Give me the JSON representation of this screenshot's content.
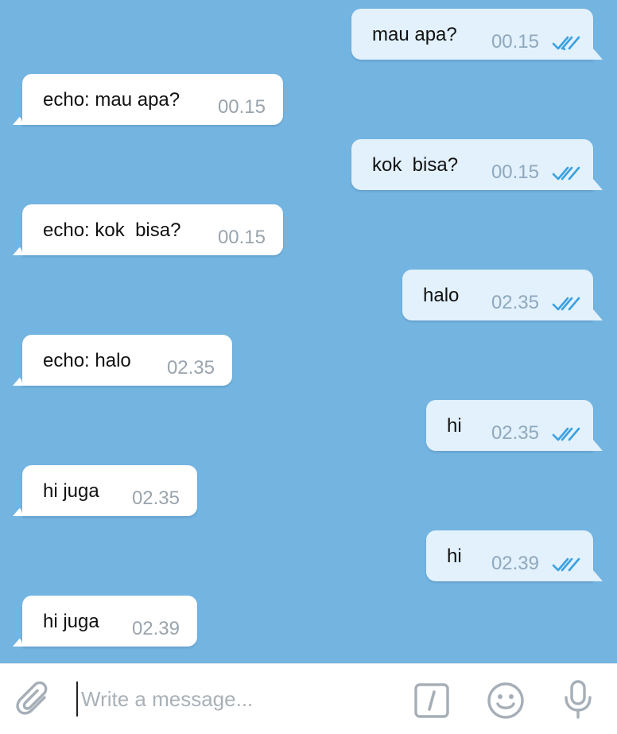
{
  "colors": {
    "chat_background": "#74b4e0",
    "incoming_bubble": "#ffffff",
    "outgoing_bubble": "#e2f1fc",
    "read_check": "#3aa0e0",
    "icon_gray": "#a6afb7"
  },
  "messages": [
    {
      "direction": "out",
      "text": "mau apa?",
      "time": "00.15",
      "status_icon": "double-check-icon"
    },
    {
      "direction": "in",
      "text": "echo: mau apa?",
      "time": "00.15"
    },
    {
      "direction": "out",
      "text": "kok  bisa?",
      "time": "00.15",
      "status_icon": "double-check-icon"
    },
    {
      "direction": "in",
      "text": "echo: kok  bisa?",
      "time": "00.15"
    },
    {
      "direction": "out",
      "text": "halo",
      "time": "02.35",
      "status_icon": "double-check-icon"
    },
    {
      "direction": "in",
      "text": "echo: halo",
      "time": "02.35"
    },
    {
      "direction": "out",
      "text": "hi",
      "time": "02.35",
      "status_icon": "double-check-icon"
    },
    {
      "direction": "in",
      "text": "hi juga",
      "time": "02.35"
    },
    {
      "direction": "out",
      "text": "hi",
      "time": "02.39",
      "status_icon": "double-check-icon"
    },
    {
      "direction": "in",
      "text": "hi juga",
      "time": "02.39"
    }
  ],
  "composer": {
    "placeholder": "Write a message...",
    "value": "",
    "icons": [
      "paperclip-icon",
      "bot-command-icon",
      "emoji-icon",
      "microphone-icon"
    ]
  }
}
